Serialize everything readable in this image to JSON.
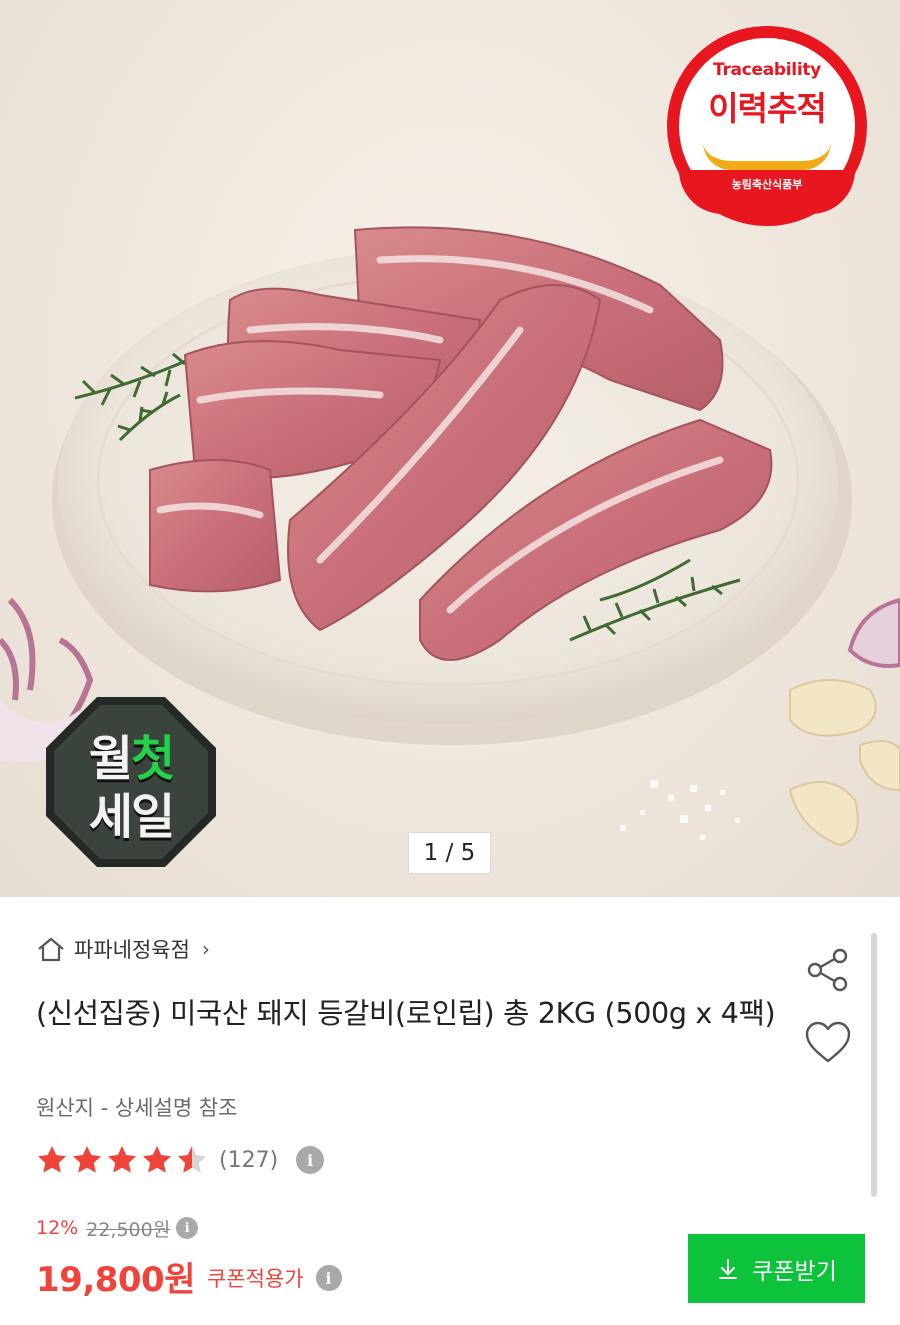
{
  "hero": {
    "pager": "1 / 5",
    "trace_badge": {
      "en": "Traceability",
      "ko": "이력추적",
      "ministry": "농림축산식품부"
    },
    "sale_badge": {
      "line1_a": "월",
      "line1_b": "첫",
      "line2": "세일"
    }
  },
  "store": {
    "name": "파파네정육점",
    "chevron": "›"
  },
  "product": {
    "title": "(신선집중) 미국산 돼지 등갈비(로인립) 총 2KG (500g x 4팩)",
    "origin": "원산지 - 상세설명 참조",
    "rating": 4.5,
    "rating_max": 5,
    "review_count": "(127)"
  },
  "price": {
    "discount": "12%",
    "original": "22,500원",
    "sale": "19,800원",
    "coupon_note": "쿠폰적용가"
  },
  "buttons": {
    "coupon": "쿠폰받기"
  },
  "colors": {
    "accent_red": "#f0443a",
    "coupon_green": "#0ec33c",
    "trace_red": "#e8161f",
    "star_empty": "#d6d6d6"
  }
}
